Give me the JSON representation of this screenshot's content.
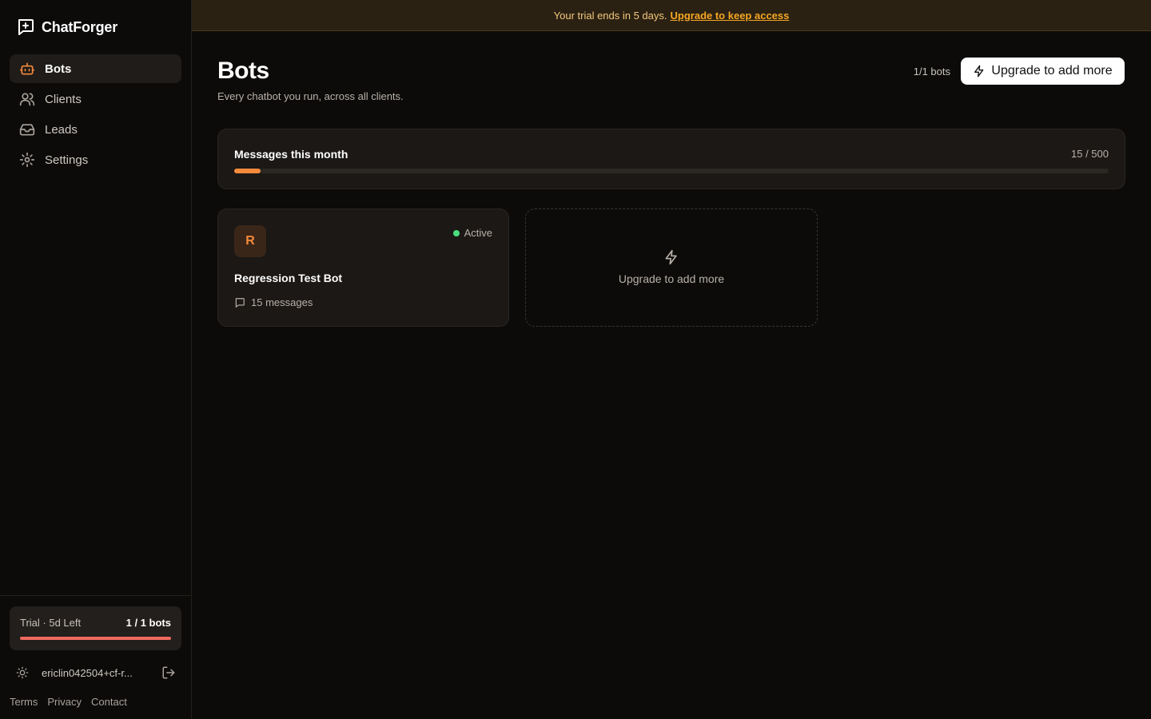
{
  "brand": {
    "name": "ChatForger",
    "icon": "chat-plus-icon"
  },
  "banner": {
    "text": "Your trial ends in 5 days.",
    "link": "Upgrade to keep access"
  },
  "sidebar": {
    "items": [
      {
        "label": "Bots",
        "icon": "bot-icon",
        "active": true
      },
      {
        "label": "Clients",
        "icon": "users-icon",
        "active": false
      },
      {
        "label": "Leads",
        "icon": "inbox-icon",
        "active": false
      },
      {
        "label": "Settings",
        "icon": "gear-icon",
        "active": false
      }
    ],
    "trial": {
      "label": "Trial · 5d Left",
      "bots": "1 / 1 bots",
      "usage_fraction": 1.0
    },
    "user": {
      "email": "ericlin042504+cf-r..."
    },
    "footer": {
      "terms": "Terms",
      "privacy": "Privacy",
      "contact": "Contact"
    }
  },
  "main": {
    "title": "Bots",
    "subtitle": "Every chatbot you run, across all clients.",
    "bots_count": "1/1 bots",
    "upgrade_button": "Upgrade to add more",
    "usage": {
      "label": "Messages this month",
      "value": "15 / 500",
      "used": 15,
      "limit": 500
    },
    "bots": [
      {
        "initial": "R",
        "name": "Regression Test Bot",
        "status": "Active",
        "messages": "15 messages"
      }
    ],
    "add_card": {
      "label": "Upgrade to add more"
    }
  },
  "colors": {
    "accent": "#f58a3c",
    "active_dot": "#4ade80",
    "trial_bar": "#f16a5f",
    "banner_text": "#f3c77a"
  }
}
